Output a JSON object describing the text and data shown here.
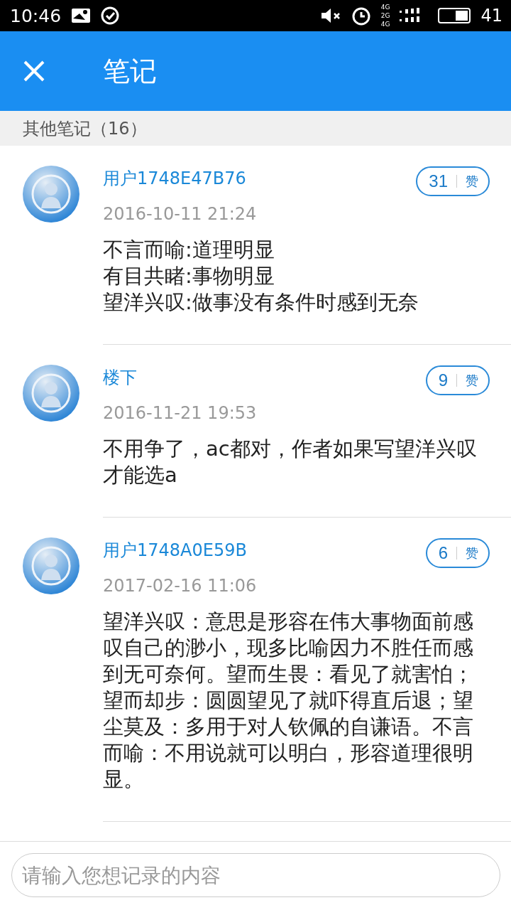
{
  "status_bar": {
    "time": "10:46",
    "network": [
      "4G",
      "2G",
      "4G"
    ],
    "battery": "41"
  },
  "header": {
    "title": "笔记"
  },
  "section": {
    "title": "其他笔记（16）"
  },
  "notes": [
    {
      "user": "用户1748E47B76",
      "likes": "31",
      "like_label": "赞",
      "date": "2016-10-11 21:24",
      "text": [
        "不言而喻:道理明显",
        "有目共睹:事物明显",
        "望洋兴叹:做事没有条件时感到无奈"
      ]
    },
    {
      "user": "楼下",
      "likes": "9",
      "like_label": "赞",
      "date": "2016-11-21 19:53",
      "text": [
        "不用争了，ac都对，作者如果写望洋兴叹才能选a"
      ]
    },
    {
      "user": "用户1748A0E59B",
      "likes": "6",
      "like_label": "赞",
      "date": "2017-02-16 11:06",
      "text": [
        "望洋兴叹：意思是形容在伟大事物面前感叹自己的渺小，现多比喻因力不胜任而感到无可奈何。望而生畏：看见了就害怕；望而却步：圆圆望见了就吓得直后退；望尘莫及：多用于对人钦佩的自谦语。不言而喻：不用说就可以明白，形容道理很明显。"
      ]
    }
  ],
  "input": {
    "placeholder": "请输入您想记录的内容"
  }
}
